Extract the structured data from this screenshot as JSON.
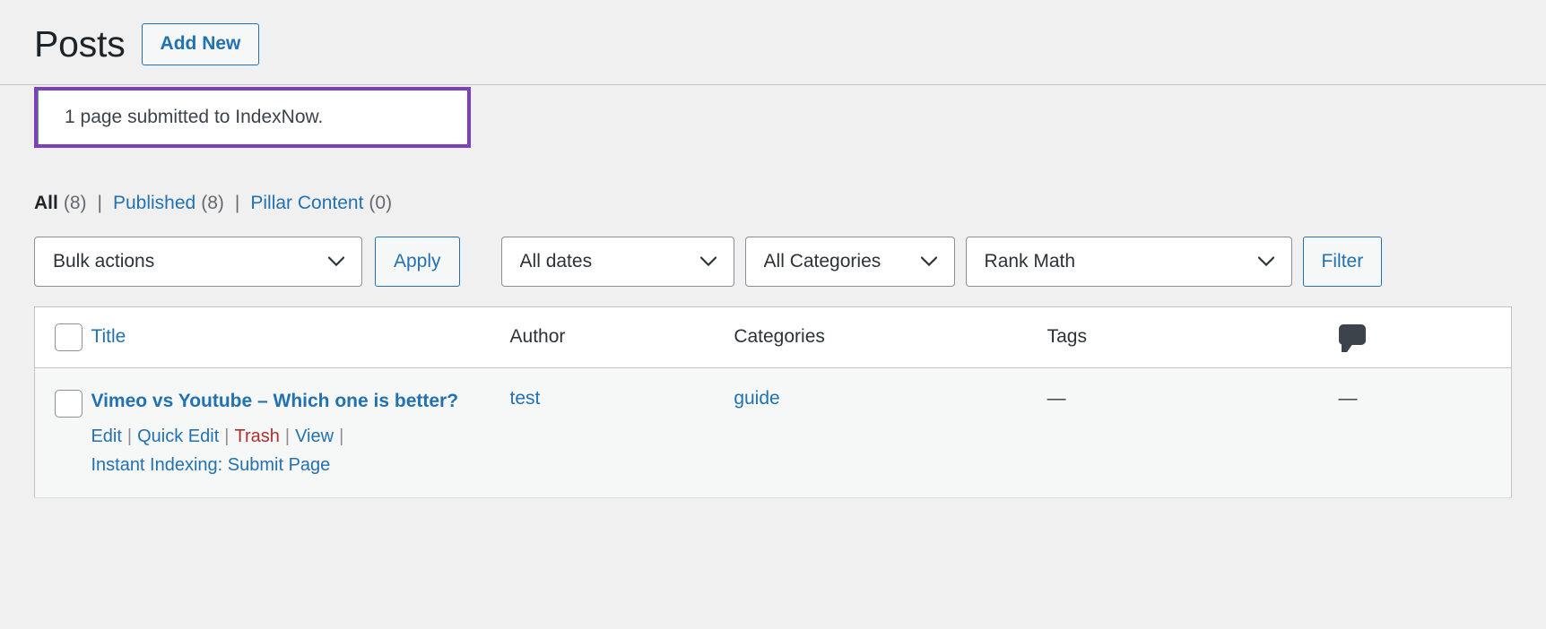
{
  "header": {
    "title": "Posts",
    "add_new_label": "Add New"
  },
  "notice": {
    "message": "1 page submitted to IndexNow.",
    "border_color": "#46b450",
    "focus_outline_color": "#7c3fbf"
  },
  "status_filters": [
    {
      "label": "All",
      "count": "(8)",
      "current": true
    },
    {
      "label": "Published",
      "count": "(8)",
      "current": false
    },
    {
      "label": "Pillar Content",
      "count": "(0)",
      "current": false
    }
  ],
  "separator": "|",
  "tablenav": {
    "bulk_actions_value": "Bulk actions",
    "apply_label": "Apply",
    "dates_value": "All dates",
    "categories_value": "All Categories",
    "rank_math_value": "Rank Math",
    "filter_label": "Filter"
  },
  "table": {
    "columns": {
      "title": "Title",
      "author": "Author",
      "categories": "Categories",
      "tags": "Tags",
      "comments_icon": "comment-bubble-icon"
    },
    "rows": [
      {
        "title": "Vimeo vs Youtube – Which one is better?",
        "actions": [
          {
            "label": "Edit",
            "style": "link"
          },
          {
            "label": "Quick Edit",
            "style": "link"
          },
          {
            "label": "Trash",
            "style": "trash"
          },
          {
            "label": "View",
            "style": "link"
          },
          {
            "label": "Instant Indexing: Submit Page",
            "style": "link"
          }
        ],
        "author": "test",
        "categories": "guide",
        "tags": "—",
        "comments": "—"
      }
    ]
  },
  "colors": {
    "link": "#2271b1",
    "trash": "#b32d2e",
    "page_bg": "#f0f0f1",
    "row_bg": "#f6f7f7"
  }
}
